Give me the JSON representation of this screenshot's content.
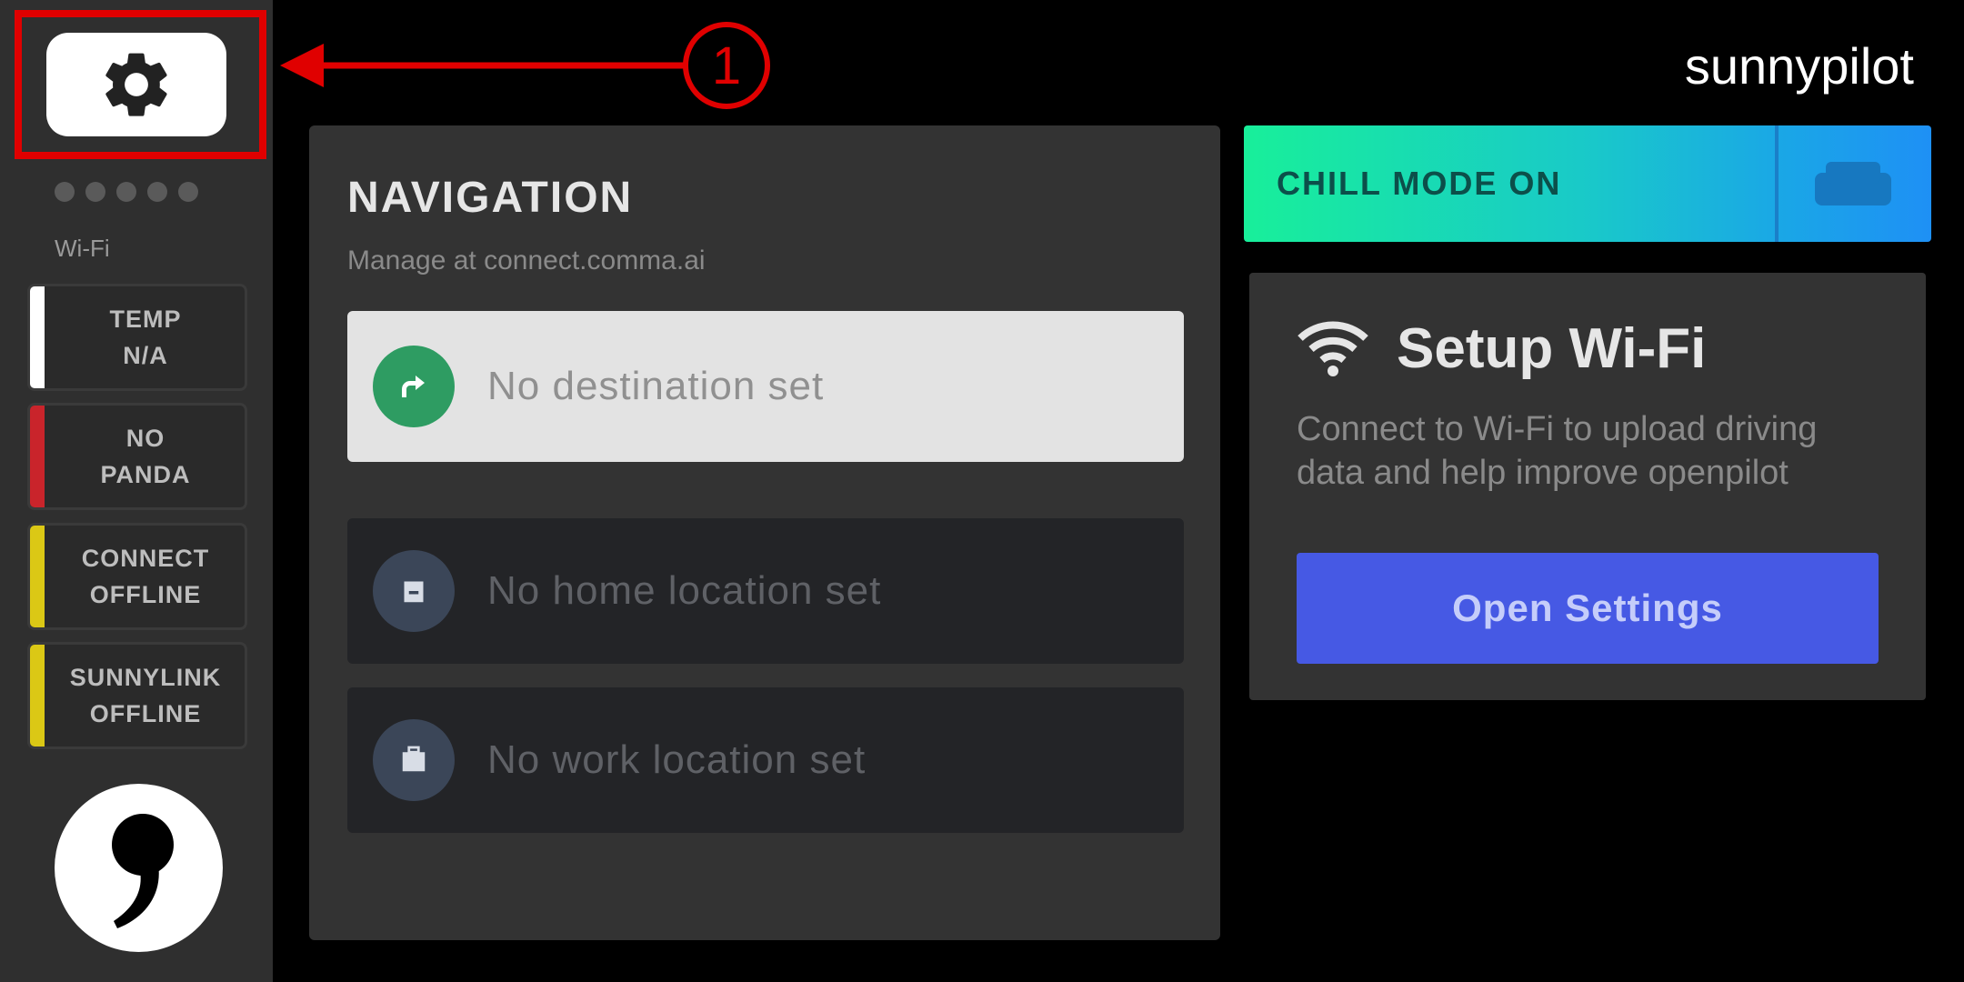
{
  "brand": "sunnypilot",
  "annotation": {
    "number": "1",
    "color": "#e00000"
  },
  "sidebar": {
    "settings_icon": "gear-icon",
    "network_label": "Wi-Fi",
    "signal_strength": 0,
    "tiles": [
      {
        "label": "TEMP\nN/A",
        "color": "#ffffff"
      },
      {
        "label": "NO\nPANDA",
        "color": "#c9242b"
      },
      {
        "label": "CONNECT\nOFFLINE",
        "color": "#dbc815"
      },
      {
        "label": "SUNNYLINK\nOFFLINE",
        "color": "#dbc815"
      }
    ],
    "logo": "comma-logo"
  },
  "navigation": {
    "title": "NAVIGATION",
    "subtitle": "Manage at connect.comma.ai",
    "rows": [
      {
        "label": "No destination set",
        "icon": "directions-icon"
      },
      {
        "label": "No home location set",
        "icon": "home-icon"
      },
      {
        "label": "No work location set",
        "icon": "work-icon"
      }
    ]
  },
  "chill_mode": {
    "label": "CHILL MODE ON",
    "icon": "couch-icon"
  },
  "wifi_card": {
    "title": "Setup Wi-Fi",
    "description": "Connect to Wi-Fi to upload driving data and help improve openpilot",
    "button": "Open Settings",
    "icon": "wifi-icon"
  }
}
